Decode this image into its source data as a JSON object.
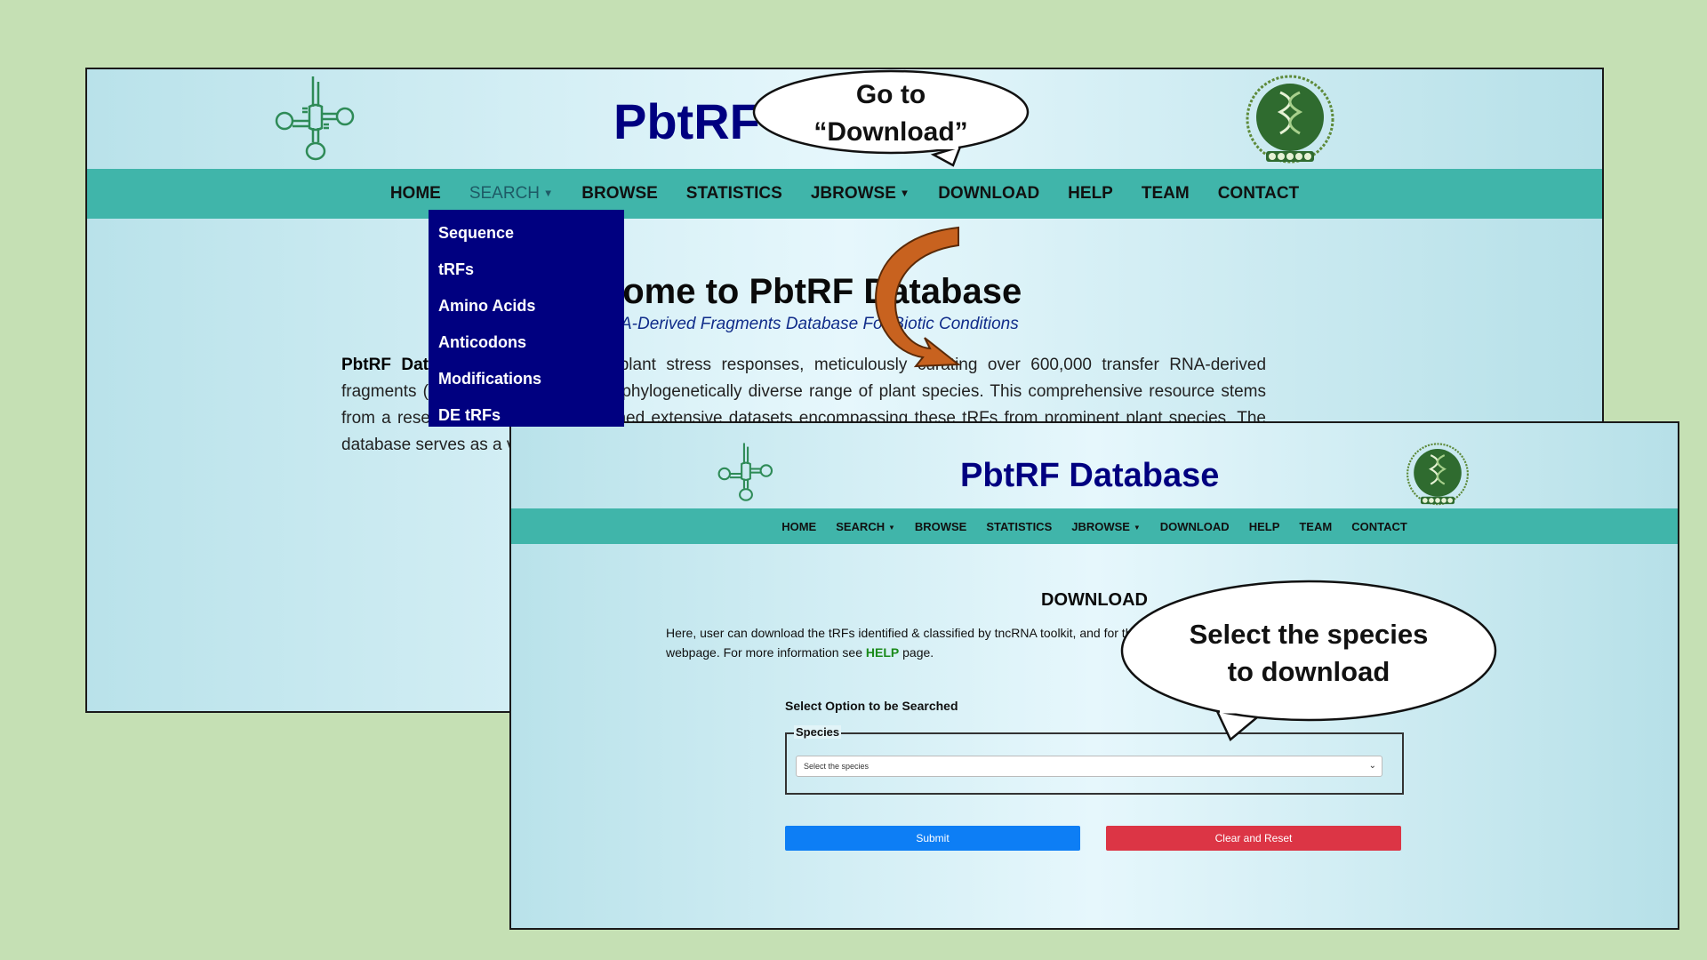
{
  "background_color": "#c5e0b4",
  "nav_color": "#40b5aa",
  "brand_color": "#000080",
  "screen1": {
    "title": "PbtRF",
    "nav": [
      {
        "label": "HOME"
      },
      {
        "label": "SEARCH",
        "icon": "caret-down-icon"
      },
      {
        "label": "BROWSE"
      },
      {
        "label": "STATISTICS"
      },
      {
        "label": "JBROWSE",
        "icon": "caret-down-icon"
      },
      {
        "label": "DOWNLOAD"
      },
      {
        "label": "HELP"
      },
      {
        "label": "TEAM"
      },
      {
        "label": "CONTACT"
      }
    ],
    "search_dropdown": [
      "Sequence",
      "tRFs",
      "Amino Acids",
      "Anticodons",
      "Modifications",
      "DE tRFs"
    ],
    "welcome_heading": "come to PbtRF Database",
    "welcome_subtitle": "A-Derived Fragments Database For Biotic Conditions",
    "intro_strong": "PbtRF Dat",
    "intro_text": "cialized repository for plant stress responses, meticulously curating over 600,000 transfer RNA-derived fragments (tRFs) identified across a phylogenetically diverse range of plant species. This comprehensive resource stems from a research initiative that examined extensive datasets encompassing these tRFs from prominent plant species. The database serves as a valuable resource for researchers studying plant stress, facilitating the exploration of tRF roles."
  },
  "screen2": {
    "title": "PbtRF Database",
    "nav": [
      {
        "label": "HOME"
      },
      {
        "label": "SEARCH",
        "icon": "caret-down-icon"
      },
      {
        "label": "BROWSE"
      },
      {
        "label": "STATISTICS"
      },
      {
        "label": "JBROWSE",
        "icon": "caret-down-icon"
      },
      {
        "label": "DOWNLOAD"
      },
      {
        "label": "HELP"
      },
      {
        "label": "TEAM"
      },
      {
        "label": "CONTACT"
      }
    ],
    "heading": "DOWNLOAD",
    "desc_before": "Here, user can download the tRFs identified & classified by tncRNA toolkit, and for the stress conditions of different plant species are available at this webpage. For more information see ",
    "help_link": "HELP",
    "desc_after": " page.",
    "select_label": "Select Option to be Searched",
    "species_legend": "Species",
    "species_placeholder": "Select the species",
    "submit_label": "Submit",
    "reset_label": "Clear and Reset",
    "submit_color": "#0d7ef5",
    "reset_color": "#dc3545"
  },
  "callouts": {
    "go_line1": "Go to",
    "go_line2": "“Download”",
    "select_line1": "Select the species",
    "select_line2": "to download"
  },
  "arrow_color": "#c8621f"
}
